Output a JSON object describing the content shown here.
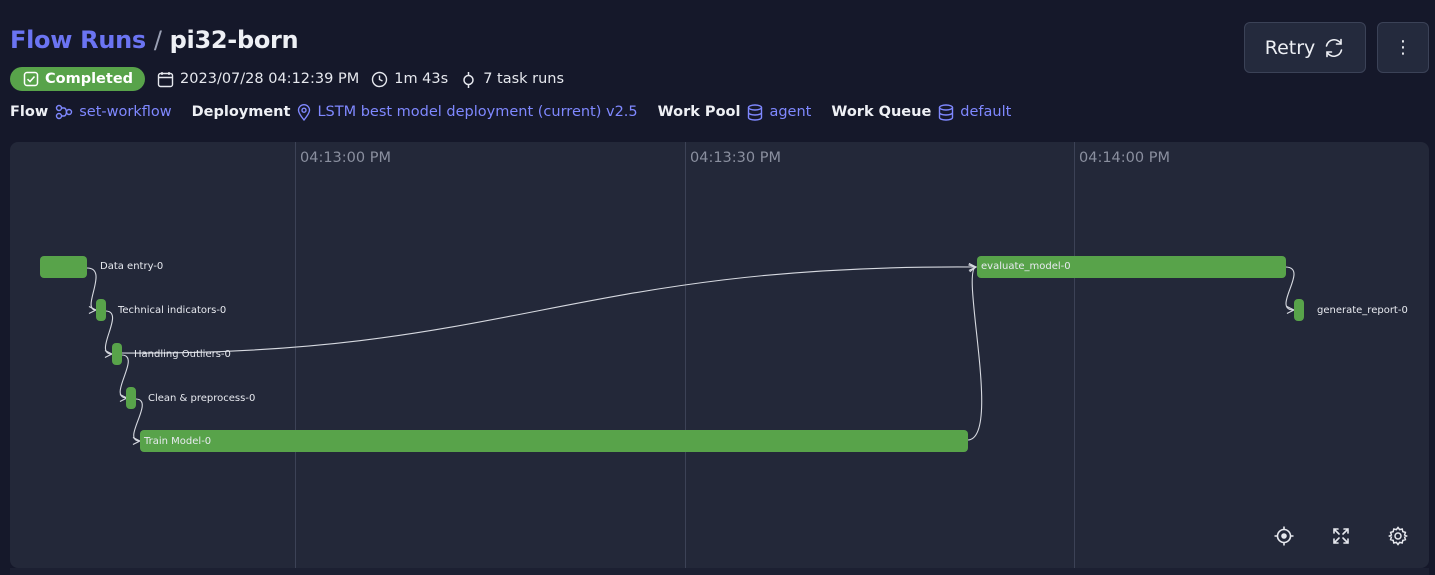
{
  "breadcrumb": {
    "root": "Flow Runs",
    "separator": "/",
    "current": "pi32-born"
  },
  "status": {
    "label": "Completed",
    "color": "#58a34a"
  },
  "meta": {
    "start_time": "2023/07/28 04:12:39 PM",
    "duration": "1m 43s",
    "task_runs": "7 task runs"
  },
  "info": {
    "flow_label": "Flow",
    "flow_value": "set-workflow",
    "deployment_label": "Deployment",
    "deployment_value": "LSTM best model deployment (current) v2.5",
    "work_pool_label": "Work Pool",
    "work_pool_value": "agent",
    "work_queue_label": "Work Queue",
    "work_queue_value": "default"
  },
  "actions": {
    "retry_label": "Retry",
    "more_label": "⋮"
  },
  "timeline": {
    "ticks": [
      "04:13:00 PM",
      "04:13:30 PM",
      "04:14:00 PM"
    ],
    "tasks": [
      {
        "name": "Data entry-0"
      },
      {
        "name": "Technical indicators-0"
      },
      {
        "name": "Handling Outliers-0"
      },
      {
        "name": "Clean & preprocess-0"
      },
      {
        "name": "Train Model-0"
      },
      {
        "name": "evaluate_model-0"
      },
      {
        "name": "generate_report-0"
      }
    ]
  },
  "colors": {
    "accent": "#6b74f2",
    "link": "#7f88ff",
    "task_bar": "#58a34a",
    "background": "#15182a",
    "panel": "#232839"
  },
  "icons": {
    "graph_controls": [
      "crosshair-icon",
      "expand-icon",
      "settings-icon"
    ]
  }
}
